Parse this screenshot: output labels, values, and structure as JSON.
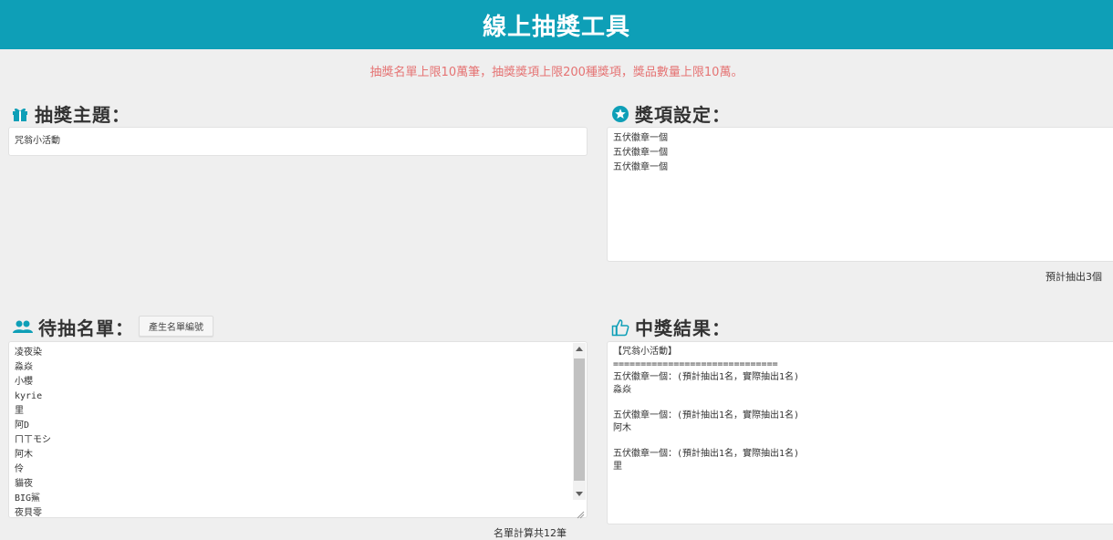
{
  "header": {
    "title": "線上抽獎工具"
  },
  "notice": "抽獎名單上限10萬筆，抽獎獎項上限200種獎項，獎品數量上限10萬。",
  "theme": {
    "title": "抽獎主題：",
    "value": "咒翁小活動",
    "icon": "gift-icon"
  },
  "prizes": {
    "title": "獎項設定：",
    "icon": "star-circle-icon",
    "value": "五伏徽章一個\n五伏徽章一個\n五伏徽章一個",
    "footer": "預計抽出3個"
  },
  "candidates": {
    "title": "待抽名單：",
    "icon": "people-icon",
    "generate_button": "產生名單編號",
    "value": "凌夜染\n淼焱\n小櫻\nkyrie\n里\n阿D\nㄇㄒモシ\n阿木\n伶\n貓夜\nBIG鯊\n夜貝零",
    "footer": "名單計算共12筆"
  },
  "results": {
    "title": "中獎結果：",
    "icon": "thumbs-up-icon",
    "value": "【咒翁小活動】\n==============================\n五伏徽章一個：(預計抽出1名，實際抽出1名)\n淼焱\n\n五伏徽章一個：(預計抽出1名，實際抽出1名)\n阿木\n\n五伏徽章一個：(預計抽出1名，實際抽出1名)\n里"
  },
  "colors": {
    "accent": "#0e9fb7",
    "notice": "#e57373",
    "background": "#efefef"
  }
}
